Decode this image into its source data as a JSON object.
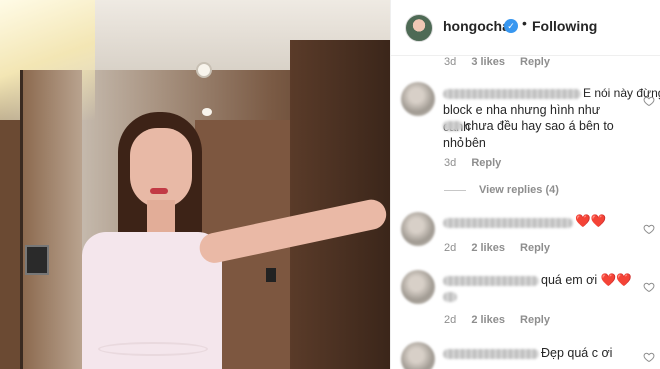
{
  "header": {
    "username": "hongocha",
    "verified_glyph": "✓",
    "separator": "•",
    "follow_label": "Following"
  },
  "comments": [
    {
      "age": "3d",
      "likes": "3 likes",
      "reply": "Reply"
    },
    {
      "text_line1": "E nói này đừng",
      "text_line2": "block e nha nhưng hình như canh",
      "text_line3": "chưa đều hay sao á bên to bên",
      "text_line4": "nhỏ",
      "age": "3d",
      "reply": "Reply",
      "view_replies": "View replies (4)"
    },
    {
      "hearts": "❤️❤️",
      "age": "2d",
      "likes": "2 likes",
      "reply": "Reply"
    },
    {
      "text": "quá em ơi ❤️❤️",
      "age": "2d",
      "likes": "2 likes",
      "reply": "Reply"
    },
    {
      "text": "Đẹp quá c ơi"
    }
  ],
  "icons": {
    "verified": "verified-badge-icon",
    "like": "heart-outline-icon"
  },
  "colors": {
    "verified_blue": "#3897f0",
    "meta_gray": "#8e8e8e",
    "heart_red": "#e0242f"
  }
}
